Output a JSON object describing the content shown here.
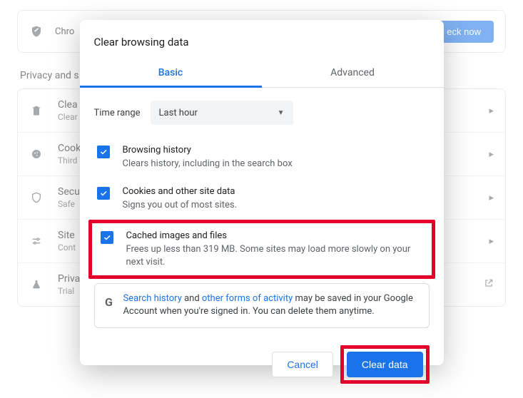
{
  "bg": {
    "top_text": "Chro",
    "check_now": "eck now",
    "section": "Privacy and s",
    "rows": [
      {
        "t1": "Clea",
        "t2": "Clear"
      },
      {
        "t1": "Cook",
        "t2": "Third"
      },
      {
        "t1": "Secu",
        "t2": "Safe"
      },
      {
        "t1": "Site",
        "t2": "Cont"
      },
      {
        "t1": "Priva",
        "t2": "Trial"
      }
    ]
  },
  "dialog": {
    "title": "Clear browsing data",
    "tabs": {
      "basic": "Basic",
      "advanced": "Advanced"
    },
    "range_label": "Time range",
    "range_value": "Last hour",
    "options": [
      {
        "title": "Browsing history",
        "desc": "Clears history, including in the search box",
        "checked": true
      },
      {
        "title": "Cookies and other site data",
        "desc": "Signs you out of most sites.",
        "checked": true
      },
      {
        "title": "Cached images and files",
        "desc": "Frees up less than 319 MB. Some sites may load more slowly on your next visit.",
        "checked": true
      }
    ],
    "info": {
      "link1": "Search history",
      "t1": " and ",
      "link2": "other forms of activity",
      "t2": " may be saved in your Google Account when you're signed in. You can delete them anytime."
    },
    "cancel": "Cancel",
    "confirm": "Clear data"
  }
}
